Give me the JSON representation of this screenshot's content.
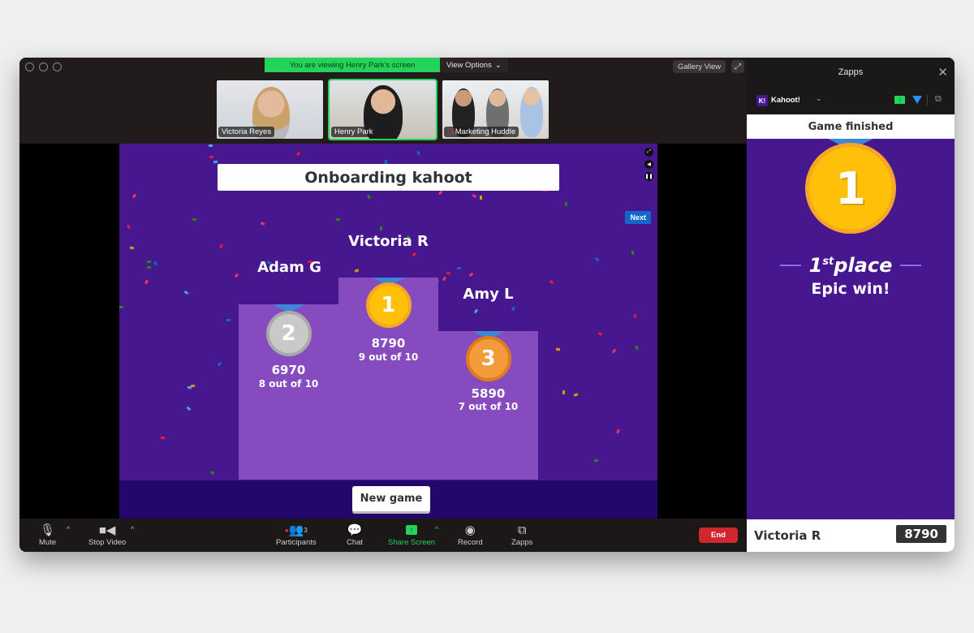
{
  "window": {
    "banner": "You are viewing Henry Park's screen",
    "view_options": "View Options",
    "gallery_view": "Gallery View"
  },
  "participants_strip": [
    {
      "name": "Victoria Reyes",
      "active": false,
      "muted": false
    },
    {
      "name": "Henry Park",
      "active": true,
      "muted": false
    },
    {
      "name": "Marketing Huddle",
      "active": false,
      "muted": true
    }
  ],
  "game": {
    "title": "Onboarding kahoot",
    "next_label": "Next",
    "new_game_label": "New game",
    "podium": [
      {
        "rank": "2",
        "name": "Adam G",
        "score": "6970",
        "correct": "8 out of 10",
        "medal_color": "#c9c9c9"
      },
      {
        "rank": "1",
        "name": "Victoria R",
        "score": "8790",
        "correct": "9 out of 10",
        "medal_color": "#ffc00a"
      },
      {
        "rank": "3",
        "name": "Amy L",
        "score": "5890",
        "correct": "7 out of 10",
        "medal_color": "#f39a3b"
      }
    ]
  },
  "toolbar": {
    "mute": "Mute",
    "stop_video": "Stop Video",
    "participants": "Participants",
    "participants_count": "3",
    "chat": "Chat",
    "share_screen": "Share Screen",
    "record": "Record",
    "zapps": "Zapps",
    "end": "End"
  },
  "panel": {
    "title": "Zapps",
    "app_name": "Kahoot!",
    "app_logo": "K!",
    "game_finished": "Game finished",
    "rank": "1",
    "place_num": "1",
    "place_sup": "st",
    "place_word": "place",
    "message": "Epic win!",
    "player_name": "Victoria R",
    "player_score": "8790"
  },
  "colors": {
    "kahoot_purple": "#46178f",
    "podium_purple": "#864cbf",
    "zoom_green": "#23d35a",
    "end_red": "#d0262d"
  }
}
